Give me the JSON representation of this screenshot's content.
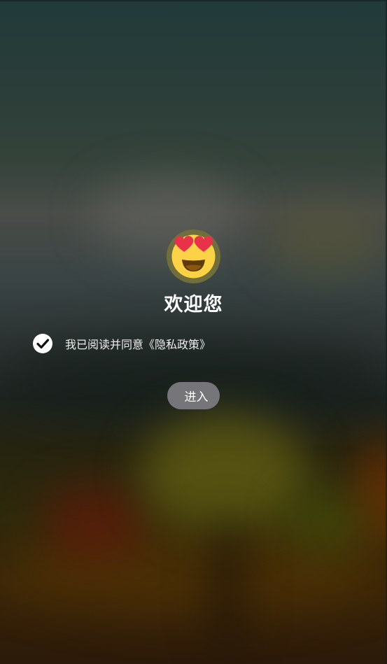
{
  "welcome": {
    "title": "欢迎您",
    "avatar_icon": "heart-eyes-emoji-icon"
  },
  "agreement": {
    "checked": true,
    "text": "我已阅读并同意《隐私政策》",
    "check_icon": "check-circle-icon"
  },
  "enter_button": {
    "label": "进入"
  },
  "colors": {
    "button_bg": "#76767a",
    "avatar_ring": "#6f6e3c",
    "text": "#ffffff"
  }
}
